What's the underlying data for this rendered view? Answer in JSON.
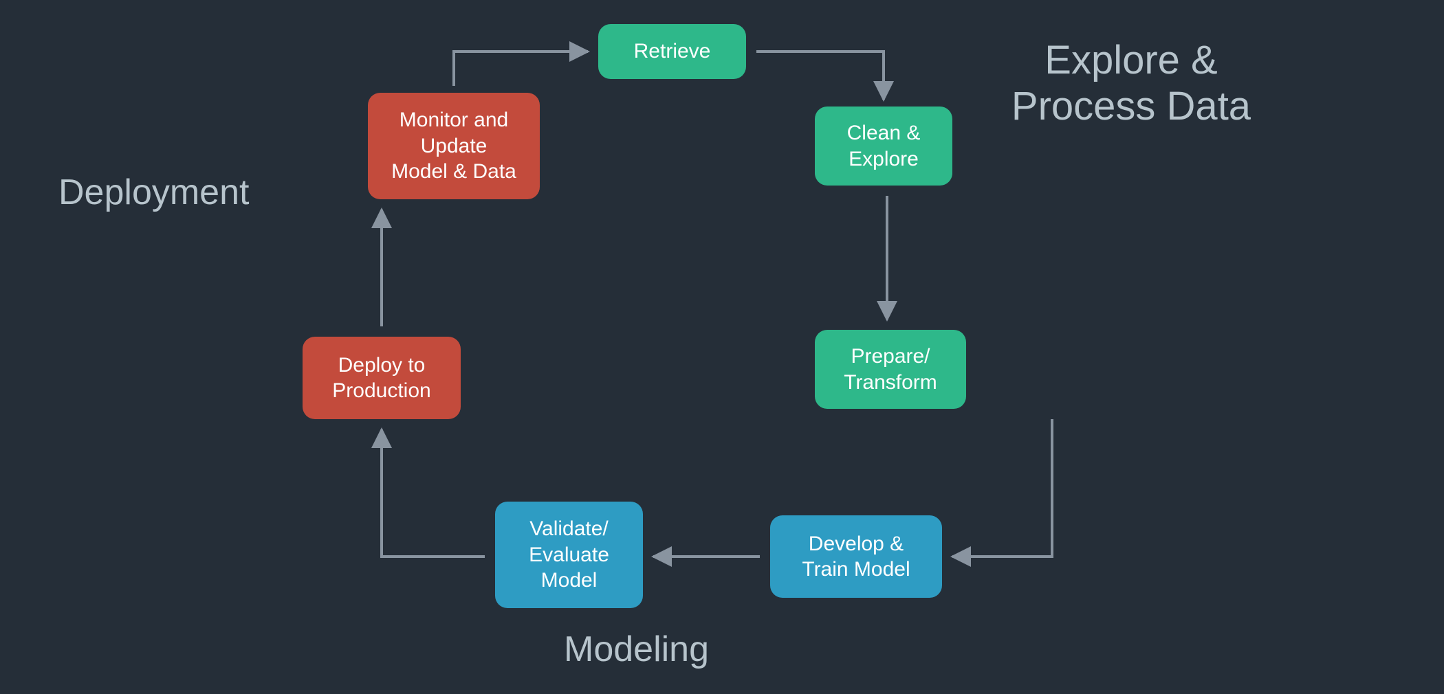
{
  "sections": {
    "explore": "Explore &\nProcess Data",
    "modeling": "Modeling",
    "deployment": "Deployment"
  },
  "nodes": {
    "retrieve": {
      "label": "Retrieve",
      "color": "green"
    },
    "clean_explore": {
      "label": "Clean &\nExplore",
      "color": "green"
    },
    "prepare_transform": {
      "label": "Prepare/\nTransform",
      "color": "green"
    },
    "develop_train": {
      "label": "Develop &\nTrain Model",
      "color": "blue"
    },
    "validate_evaluate": {
      "label": "Validate/\nEvaluate\nModel",
      "color": "blue"
    },
    "deploy_production": {
      "label": "Deploy to\nProduction",
      "color": "red"
    },
    "monitor_update": {
      "label": "Monitor and\nUpdate\nModel & Data",
      "color": "red"
    }
  },
  "flow_order": [
    "retrieve",
    "clean_explore",
    "prepare_transform",
    "develop_train",
    "validate_evaluate",
    "deploy_production",
    "monitor_update"
  ],
  "colors": {
    "background": "#252e38",
    "text": "#b7c4cc",
    "arrow": "#8994a0",
    "green": "#2eb88a",
    "blue": "#2e9cc3",
    "red": "#c34b3c"
  }
}
